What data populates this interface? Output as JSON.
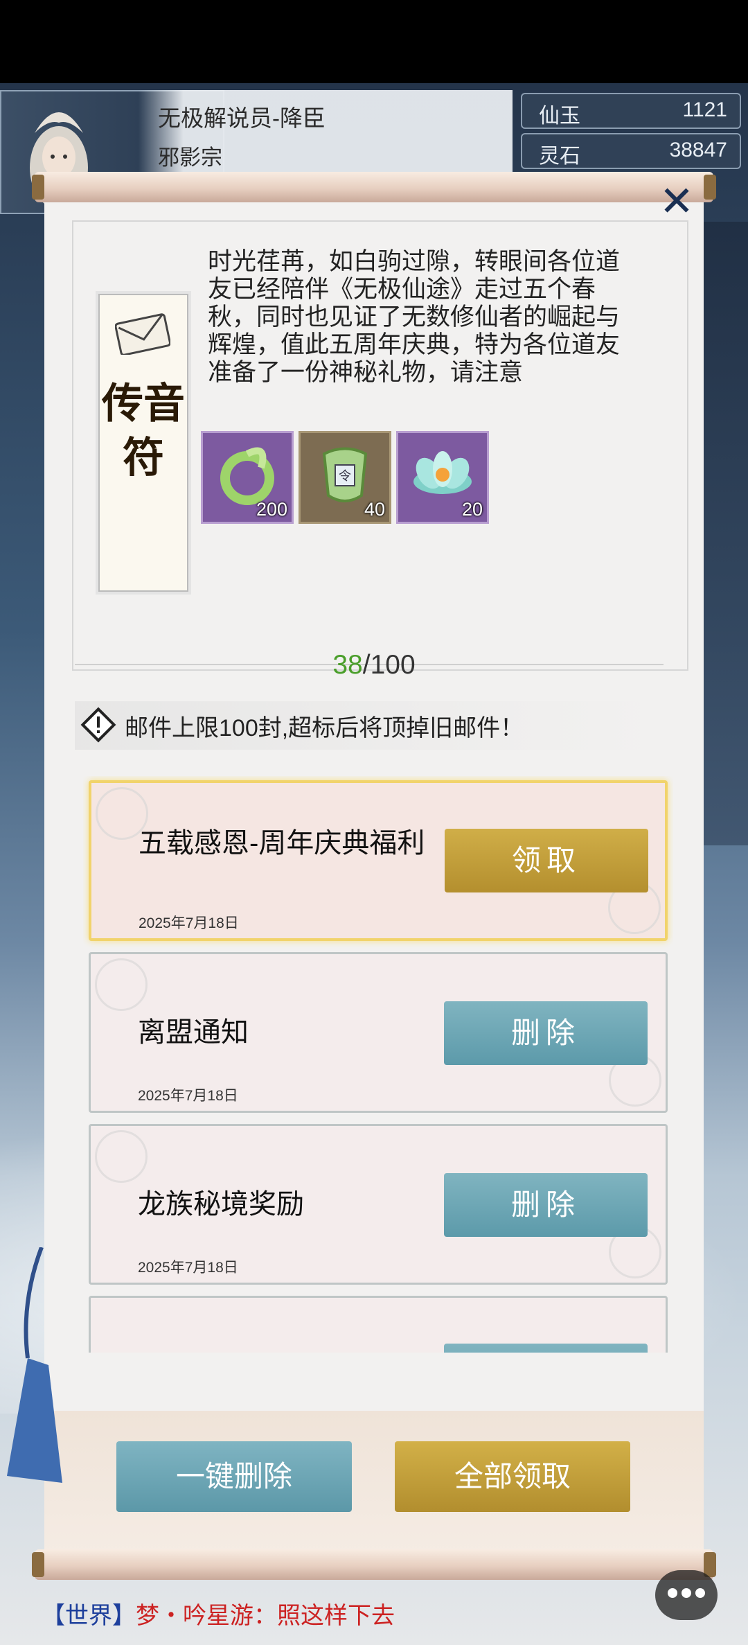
{
  "player": {
    "name": "无极解说员-降臣",
    "sect": "邪影宗"
  },
  "currencies": [
    {
      "label": "仙玉",
      "value": "1121"
    },
    {
      "label": "灵石",
      "value": "38847"
    }
  ],
  "mail_detail": {
    "talisman_title": "传音符",
    "body": "时光荏苒，如白驹过隙，转眼间各位道友已经陪伴《无极仙途》走过五个春秋，同时也见证了无数修仙者的崛起与辉煌，值此五周年庆典，特为各位道友准备了一份神秘礼物，请注意",
    "rewards": [
      {
        "icon": "jade-ring-icon",
        "count": "200"
      },
      {
        "icon": "token-icon",
        "count": "40"
      },
      {
        "icon": "lotus-icon",
        "count": "20"
      }
    ]
  },
  "mailbox": {
    "count_current": "38",
    "count_max": "/100",
    "notice": "邮件上限100封,超标后将顶掉旧邮件！"
  },
  "mails": [
    {
      "title": "五载感恩-周年庆典福利",
      "date": "2025年7月18日",
      "button": "领取",
      "state": "unread"
    },
    {
      "title": "离盟通知",
      "date": "2025年7月18日",
      "button": "删除",
      "state": "read"
    },
    {
      "title": "龙族秘境奖励",
      "date": "2025年7月18日",
      "button": "删除",
      "state": "read"
    }
  ],
  "actions": {
    "delete_all": "一键删除",
    "claim_all": "全部领取"
  },
  "chat": {
    "channel": "【世界】",
    "message": "梦・吟星游：照这样下去"
  },
  "colors": {
    "gold_button": "#c3a03c",
    "teal_button": "#6ea7b6",
    "count_green": "#4a9e2a"
  }
}
